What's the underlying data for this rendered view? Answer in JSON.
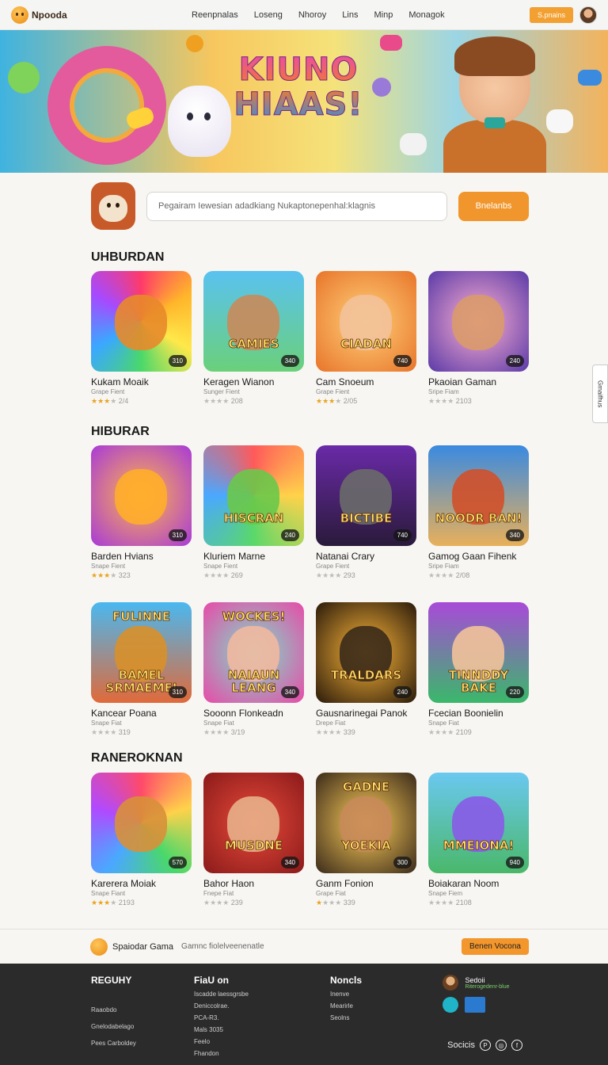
{
  "header": {
    "logo_text": "Npooda",
    "nav": [
      "Reenpnalas",
      "Loseng",
      "Nhoroy",
      "Lins",
      "Minp",
      "Monagok"
    ],
    "signin_label": "S.pnains"
  },
  "banner": {
    "title_line1": "KIUNO",
    "title_line2": "HIAAS!"
  },
  "search": {
    "placeholder": "Pegairam Iewesian adadkiang Nukaptonepenhal:klagnis",
    "button_label": "Bnelanbs"
  },
  "side_tab_label": "Gmaifhus",
  "sections": [
    {
      "title": "UHBURDAN",
      "games": [
        {
          "name": "Kukam Moaik",
          "sub": "Grape Fient",
          "rating_text": "2/4",
          "stars": 3,
          "badge": "310",
          "thumb_text": ""
        },
        {
          "name": "Keragen Wianon",
          "sub": "Sunger Fient",
          "rating_text": "208",
          "stars": 0,
          "badge": "340",
          "thumb_text": "CAMIES"
        },
        {
          "name": "Cam Snoeum",
          "sub": "Grape Fient",
          "rating_text": "2/05",
          "stars": 3,
          "badge": "740",
          "thumb_text": "CIADAN"
        },
        {
          "name": "Pkaoian Gaman",
          "sub": "Sripe Fiam",
          "rating_text": "2103",
          "stars": 0,
          "badge": "240",
          "thumb_text": ""
        }
      ]
    },
    {
      "title": "HIBURAR",
      "games": [
        {
          "name": "Barden Hvians",
          "sub": "Snape Fient",
          "rating_text": "323",
          "stars": 3,
          "badge": "310",
          "thumb_text": ""
        },
        {
          "name": "Kluriem Marne",
          "sub": "Snape Fient",
          "rating_text": "269",
          "stars": 0,
          "badge": "240",
          "thumb_text": "HISCRAN"
        },
        {
          "name": "Natanai Crary",
          "sub": "Grape Fient",
          "rating_text": "293",
          "stars": 0,
          "badge": "740",
          "thumb_text": "BICTIBE"
        },
        {
          "name": "Gamog Gaan Fihenk",
          "sub": "Sripe Fiam",
          "rating_text": "2/08",
          "stars": 0,
          "badge": "340",
          "thumb_text": "NOODR BAN!"
        }
      ]
    },
    {
      "title": "",
      "games": [
        {
          "name": "Kancear Poana",
          "sub": "Snape Fiat",
          "rating_text": "319",
          "stars": 0,
          "badge": "310",
          "thumb_text": "FULINNE",
          "thumb_text2": "BAMEL SRMAEMEI"
        },
        {
          "name": "Sooonn Flonkeadn",
          "sub": "Snape Fiat",
          "rating_text": "3/19",
          "stars": 0,
          "badge": "340",
          "thumb_text": "WOCKES!",
          "thumb_text2": "NAIAUN LEANG"
        },
        {
          "name": "Gausnarinegai Panok",
          "sub": "Drepe Fiat",
          "rating_text": "339",
          "stars": 0,
          "badge": "240",
          "thumb_text": "TRALDARS"
        },
        {
          "name": "Fcecian Boonielin",
          "sub": "Snape Fiat",
          "rating_text": "2109",
          "stars": 0,
          "badge": "220",
          "thumb_text": "TINNDDY BAKE"
        }
      ]
    },
    {
      "title": "RANEROKNAN",
      "games": [
        {
          "name": "Karerera Moiak",
          "sub": "Snape Fiant",
          "rating_text": "2193",
          "stars": 3,
          "badge": "570",
          "thumb_text": ""
        },
        {
          "name": "Bahor Haon",
          "sub": "Fnepe Fiat",
          "rating_text": "239",
          "stars": 0,
          "badge": "340",
          "thumb_text": "MUSDNE"
        },
        {
          "name": "Ganm Fonion",
          "sub": "Grape Fiat",
          "rating_text": "339",
          "stars": 1,
          "badge": "300",
          "thumb_text": "GADNE",
          "thumb_text2": "YOEKIA"
        },
        {
          "name": "Boiakaran Noom",
          "sub": "Snape Fiem",
          "rating_text": "2108",
          "stars": 0,
          "badge": "940",
          "thumb_text": "MMEIONA!"
        }
      ]
    }
  ],
  "bottom_bar": {
    "name": "Spaiodar Gama",
    "tagline": "Gamnc fiolelveenenatle",
    "button_label": "Benen Vocona"
  },
  "footer": {
    "col1": {
      "head": "REGUHY",
      "links": [
        "Raaobdo",
        "Gnelodabelago",
        "Pees Carboldey"
      ]
    },
    "col2": {
      "head": "FiaU on",
      "links": [
        "Iscadde laessgrsbe",
        "Deniccolrae.",
        "PCA-R3.",
        "Mals 3035",
        "Feelo",
        "Fhandon"
      ]
    },
    "col3": {
      "head": "Noncls",
      "links": [
        "Inenve",
        "Mearirle",
        "Seolns"
      ]
    },
    "col4": {
      "name": "Sedoii",
      "sub": "Riterogedenr-blue"
    },
    "socials_label": "Socicis"
  },
  "colors": {
    "accent": "#f1962c",
    "footer_bg": "#2b2b2b",
    "page_bg": "#f7f6f2"
  }
}
